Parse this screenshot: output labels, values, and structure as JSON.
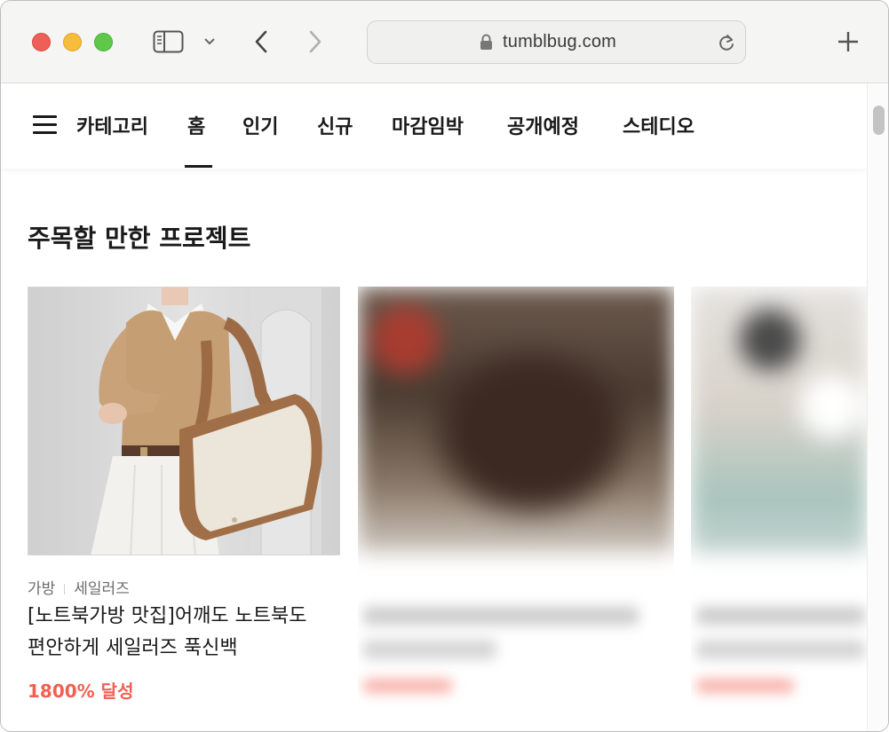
{
  "browser": {
    "url": "tumblbug.com",
    "icons": {
      "sidebar_toggle": "sidebar-icon",
      "tab_overview": "chevron-down-icon",
      "back": "chevron-left-icon",
      "forward": "chevron-right-icon",
      "lock": "lock-icon",
      "reload": "reload-icon",
      "new_tab": "plus-icon"
    }
  },
  "nav": {
    "menu_icon": "hamburger-icon",
    "items": [
      {
        "label": "카테고리"
      },
      {
        "label": "홈"
      },
      {
        "label": "인기"
      },
      {
        "label": "신규"
      },
      {
        "label": "마감임박"
      },
      {
        "label": "공개예정"
      },
      {
        "label": "스테디오"
      }
    ],
    "active": "홈"
  },
  "section": {
    "title": "주목할 만한 프로젝트"
  },
  "cards": [
    {
      "category": "가방",
      "creator": "세일러즈",
      "title_line1": "[노트북가방 맛집]어깨도 노트북도",
      "title_line2": "편안하게 세일러즈 푹신백",
      "status": "1800% 달성"
    }
  ],
  "colors": {
    "accent": "#f15f50",
    "text": "#1a1a1a",
    "muted": "#6b6b6b"
  }
}
